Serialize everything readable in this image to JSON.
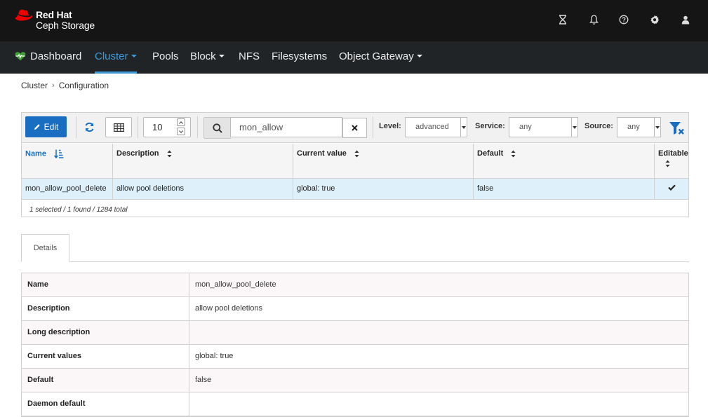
{
  "header": {
    "brand_line1": "Red Hat",
    "brand_line2": "Ceph Storage",
    "brand_color": "#ee0000",
    "icons": [
      "hourglass-icon",
      "bell-icon",
      "help-icon",
      "gear-icon",
      "user-icon"
    ]
  },
  "nav": {
    "items": [
      {
        "label": "Dashboard",
        "icon": "heartbeat-icon",
        "dropdown": false
      },
      {
        "label": "Cluster",
        "dropdown": true,
        "active": true
      },
      {
        "label": "Pools",
        "dropdown": false
      },
      {
        "label": "Block",
        "dropdown": true
      },
      {
        "label": "NFS",
        "dropdown": false
      },
      {
        "label": "Filesystems",
        "dropdown": false
      },
      {
        "label": "Object Gateway",
        "dropdown": true
      }
    ],
    "active_color": "#3f9bd8"
  },
  "breadcrumb": [
    "Cluster",
    "Configuration"
  ],
  "toolbar": {
    "edit_label": "Edit",
    "page_size": "10",
    "search_value": "mon_allow",
    "level_label": "Level:",
    "level_value": "advanced",
    "service_label": "Service:",
    "service_value": "any",
    "source_label": "Source:",
    "source_value": "any"
  },
  "table": {
    "columns": [
      "Name",
      "Description",
      "Current value",
      "Default",
      "Editable"
    ],
    "rows": [
      {
        "name": "mon_allow_pool_delete",
        "description": "allow pool deletions",
        "current_value": "global: true",
        "default": "false",
        "editable": true
      }
    ],
    "footer": "1 selected / 1 found / 1284 total",
    "selected_row_color": "#def1fb"
  },
  "tabs": [
    "Details"
  ],
  "details": [
    {
      "key": "Name",
      "value": "mon_allow_pool_delete"
    },
    {
      "key": "Description",
      "value": "allow pool deletions"
    },
    {
      "key": "Long description",
      "value": ""
    },
    {
      "key": "Current values",
      "value": "global: true"
    },
    {
      "key": "Default",
      "value": "false"
    },
    {
      "key": "Daemon default",
      "value": ""
    }
  ]
}
